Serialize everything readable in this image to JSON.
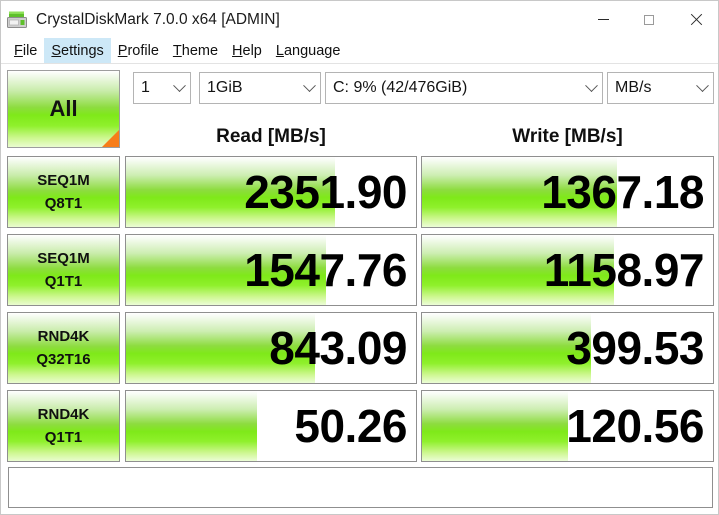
{
  "window": {
    "title": "CrystalDiskMark 7.0.0 x64 [ADMIN]",
    "icon": "crystaldiskmark-icon",
    "controls": {
      "minimize": "minimize-icon",
      "maximize": "maximize-icon",
      "close": "close-icon"
    }
  },
  "menubar": {
    "items": [
      {
        "label": "File",
        "accel": "F",
        "rest": "ile",
        "active": false
      },
      {
        "label": "Settings",
        "accel": "S",
        "rest": "ettings",
        "active": true
      },
      {
        "label": "Profile",
        "accel": "P",
        "rest": "rofile",
        "active": false
      },
      {
        "label": "Theme",
        "accel": "T",
        "rest": "heme",
        "active": false
      },
      {
        "label": "Help",
        "accel": "H",
        "rest": "elp",
        "active": false
      },
      {
        "label": "Language",
        "accel": "L",
        "rest": "anguage",
        "active": false
      }
    ]
  },
  "toolbar": {
    "all_button_label": "All",
    "loops": {
      "value": "1",
      "label": "test-count"
    },
    "test_size": {
      "value": "1GiB",
      "label": "test-size"
    },
    "drive": {
      "value": "C: 9% (42/476GiB)",
      "label": "target-drive"
    },
    "unit": {
      "value": "MB/s",
      "label": "measurement-unit"
    }
  },
  "columns": {
    "read_header": "Read [MB/s]",
    "write_header": "Write [MB/s]"
  },
  "status": {
    "text": ""
  },
  "colors": {
    "bar_green": "#7FE919",
    "accent_orange": "#F77D19",
    "menu_highlight": "#CDE8F7"
  },
  "chart_data": {
    "type": "bar",
    "title": "CrystalDiskMark 7.0.0 x64 [ADMIN]",
    "unit": "MB/s",
    "test_size": "1GiB",
    "loops": "1",
    "drive": "C: 9% (42/476GiB)",
    "categories": [
      "SEQ1M Q8T1",
      "SEQ1M Q1T1",
      "RND4K Q32T16",
      "RND4K Q1T1"
    ],
    "series": [
      {
        "name": "Read [MB/s]",
        "values": [
          2351.9,
          1547.76,
          843.09,
          50.26
        ]
      },
      {
        "name": "Write [MB/s]",
        "values": [
          1367.18,
          1158.97,
          399.53,
          120.56
        ]
      }
    ],
    "rows": [
      {
        "label_main": "SEQ1M",
        "label_sub": "Q8T1",
        "read": {
          "value": "2351.90",
          "fill_pct": 72
        },
        "write": {
          "value": "1367.18",
          "fill_pct": 67
        }
      },
      {
        "label_main": "SEQ1M",
        "label_sub": "Q1T1",
        "read": {
          "value": "1547.76",
          "fill_pct": 69
        },
        "write": {
          "value": "1158.97",
          "fill_pct": 66
        }
      },
      {
        "label_main": "RND4K",
        "label_sub": "Q32T16",
        "read": {
          "value": "843.09",
          "fill_pct": 65
        },
        "write": {
          "value": "399.53",
          "fill_pct": 58
        }
      },
      {
        "label_main": "RND4K",
        "label_sub": "Q1T1",
        "read": {
          "value": "50.26",
          "fill_pct": 45
        },
        "write": {
          "value": "120.56",
          "fill_pct": 50
        }
      }
    ]
  }
}
